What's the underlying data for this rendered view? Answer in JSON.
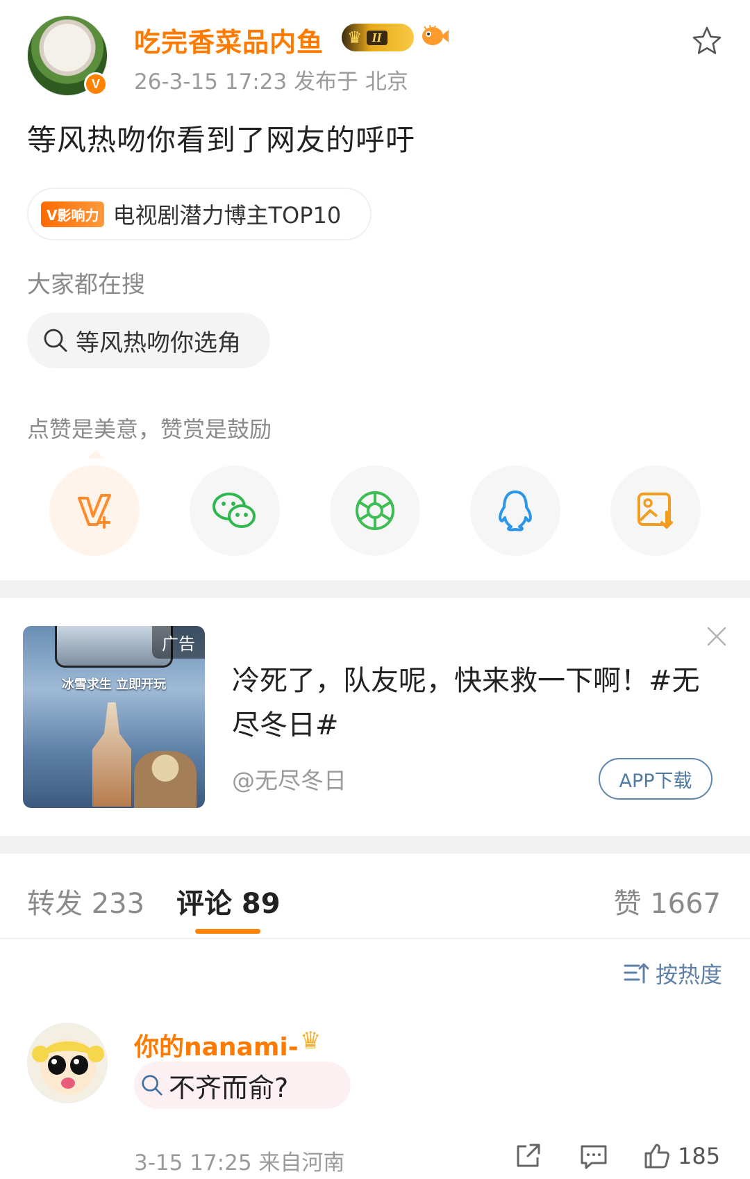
{
  "post": {
    "author": "吃完香菜品内鱼",
    "level_badge": "II",
    "meta": "26-3-15 17:23  发布于 北京",
    "body": "等风热吻你看到了网友的呼吁",
    "influence_badge": "V影响力",
    "influence_text": "电视剧潜力博主TOP10",
    "search_heading": "大家都在搜",
    "search_query": "等风热吻你选角",
    "reward_text": "点赞是美意，赞赏是鼓励",
    "share_icons": [
      "v-plus-icon",
      "wechat-icon",
      "moments-icon",
      "qq-icon",
      "save-image-icon"
    ]
  },
  "ad": {
    "tag": "广告",
    "image_banner": "冰雪求生 立即开玩",
    "title": "冷死了，队友呢，快来救一下啊！#无尽冬日#",
    "handle": "@无尽冬日",
    "button": "APP下载"
  },
  "tabs": {
    "repost": "转发 233",
    "comment": "评论 89",
    "like": "赞 1667"
  },
  "sort": {
    "label": "按热度"
  },
  "comment": {
    "user": "你的nanami-",
    "query": "不齐而俞?",
    "meta": "3-15 17:25  来自河南",
    "likes": "185"
  },
  "colors": {
    "accent": "#ff8200",
    "link_blue": "#5f7fa6",
    "muted": "#9a9a9a"
  }
}
